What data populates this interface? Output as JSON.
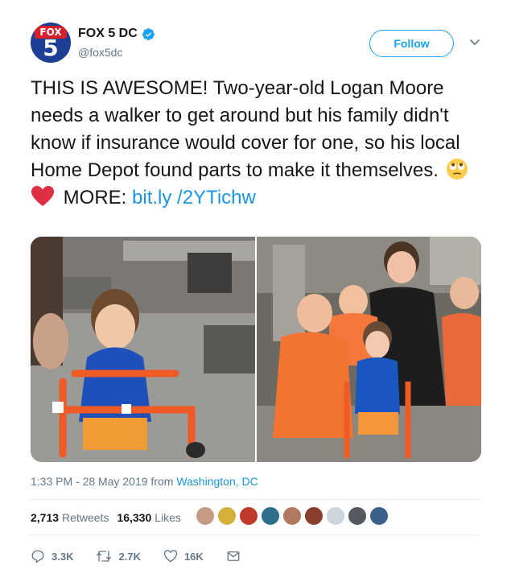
{
  "account": {
    "avatar_text_top": "FOX",
    "avatar_text_number": "5",
    "name": "FOX 5 DC",
    "handle": "@fox5dc",
    "verified": true
  },
  "follow_label": "Follow",
  "tweet": {
    "text_main": "THIS IS AWESOME! Two-year-old Logan Moore needs a walker to get around but his family didn't know if insurance would cover for one, so his local Home Depot found parts to make it themselves.",
    "emojis": [
      "face-with-rolling-eyes-emoji",
      "red-heart-emoji"
    ],
    "more_label": "MORE:",
    "link_text": "bit.ly /2YTichw"
  },
  "timestamp": {
    "time_date": "1:33 PM - 28 May 2019 from",
    "location": "Washington, DC"
  },
  "stats": {
    "retweets_count": "2,713",
    "retweets_label": "Retweets",
    "likes_count": "16,330",
    "likes_label": "Likes"
  },
  "actions": {
    "replies": "3.3K",
    "retweets": "2.7K",
    "likes": "16K"
  },
  "colors": {
    "accent": "#1da1f2",
    "link": "#1b95e0",
    "muted": "#657786"
  }
}
